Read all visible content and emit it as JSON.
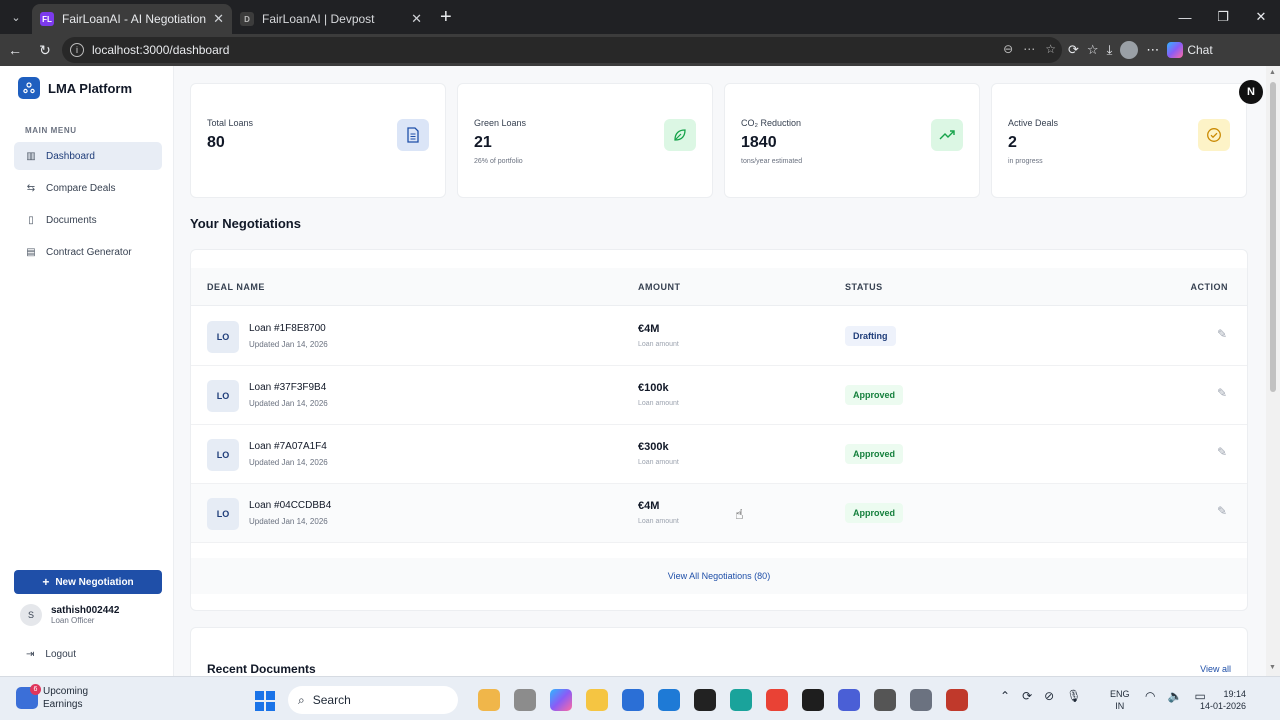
{
  "browser": {
    "tabs": [
      {
        "favicon": "FL",
        "title": "FairLoanAI - AI Negotiation Platfo",
        "active": true
      },
      {
        "favicon": "D",
        "title": "FairLoanAI | Devpost",
        "active": false
      }
    ],
    "url": "localhost:3000/dashboard",
    "chat_label": "Chat"
  },
  "sidebar": {
    "brand": "LMA Platform",
    "menu_label": "MAIN MENU",
    "items": [
      {
        "label": "Dashboard",
        "icon": "bar-chart-icon",
        "active": true
      },
      {
        "label": "Compare Deals",
        "icon": "arrows-swap-icon",
        "active": false
      },
      {
        "label": "Documents",
        "icon": "document-icon",
        "active": false
      },
      {
        "label": "Contract Generator",
        "icon": "contract-icon",
        "active": false
      }
    ],
    "new_button": "New Negotiation",
    "user": {
      "initial": "S",
      "name": "sathish002442",
      "role": "Loan Officer"
    },
    "logout": "Logout"
  },
  "stats": [
    {
      "label": "Total Loans",
      "value": "80",
      "sub": "",
      "icon": "document-icon",
      "color": "#dbe5f7",
      "icon_color": "#1f4fa8"
    },
    {
      "label": "Green Loans",
      "value": "21",
      "sub": "26% of portfolio",
      "icon": "leaf-icon",
      "color": "#dcf7e4",
      "icon_color": "#16a34a"
    },
    {
      "label": "CO₂ Reduction",
      "value": "1840",
      "sub": "tons/year estimated",
      "icon": "trending-up-icon",
      "color": "#dcf7e4",
      "icon_color": "#16a34a"
    },
    {
      "label": "Active Deals",
      "value": "2",
      "sub": "in progress",
      "icon": "check-circle-icon",
      "color": "#fdf3c7",
      "icon_color": "#ca8a04"
    }
  ],
  "negotiations": {
    "title": "Your Negotiations",
    "columns": [
      "DEAL NAME",
      "AMOUNT",
      "STATUS",
      "ACTION"
    ],
    "rows": [
      {
        "badge": "LO",
        "name": "Loan #1F8E8700",
        "updated": "Updated Jan 14, 2026",
        "amount": "€4M",
        "amount_sub": "Loan amount",
        "status": "Drafting"
      },
      {
        "badge": "LO",
        "name": "Loan #37F3F9B4",
        "updated": "Updated Jan 14, 2026",
        "amount": "€100k",
        "amount_sub": "Loan amount",
        "status": "Approved"
      },
      {
        "badge": "LO",
        "name": "Loan #7A07A1F4",
        "updated": "Updated Jan 14, 2026",
        "amount": "€300k",
        "amount_sub": "Loan amount",
        "status": "Approved"
      },
      {
        "badge": "LO",
        "name": "Loan #04CCDBB4",
        "updated": "Updated Jan 14, 2026",
        "amount": "€4M",
        "amount_sub": "Loan amount",
        "status": "Approved"
      }
    ],
    "view_all": "View All Negotiations (80)"
  },
  "recent_documents": {
    "title": "Recent Documents",
    "view_all": "View all"
  },
  "profile_badge": "N",
  "taskbar": {
    "weather_title": "Upcoming",
    "weather_sub": "Earnings",
    "weather_count": "6",
    "search": "Search",
    "lang_1": "ENG",
    "lang_2": "IN",
    "time": "19:14",
    "date": "14-01-2026"
  }
}
